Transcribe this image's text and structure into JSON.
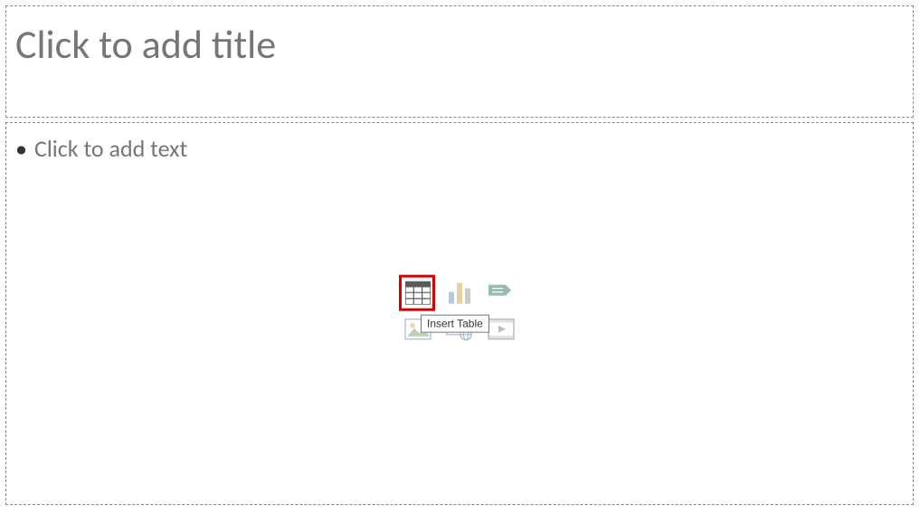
{
  "title": {
    "placeholder": "Click to add title"
  },
  "content": {
    "placeholder": "Click to add text"
  },
  "insert_icons": {
    "table": "Insert Table",
    "chart": "Insert Chart",
    "smartart": "Insert SmartArt Graphic",
    "pictures": "Pictures",
    "online_pictures": "Online Pictures",
    "video": "Insert Video"
  },
  "tooltip": "Insert Table"
}
